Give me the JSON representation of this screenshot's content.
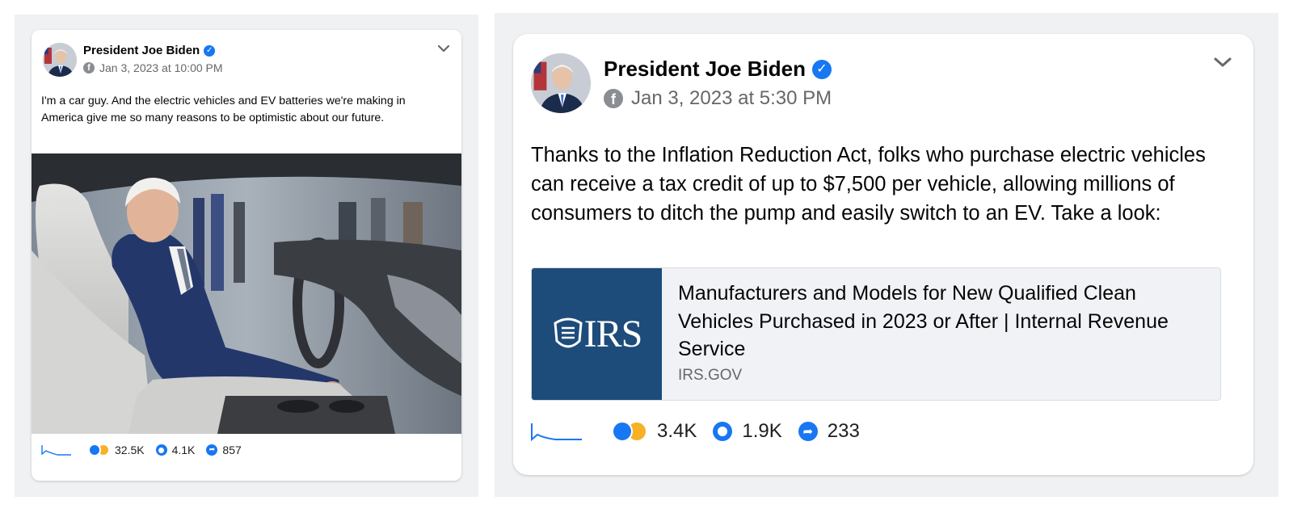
{
  "posts": [
    {
      "author": "President Joe Biden",
      "verified": true,
      "timestamp": "Jan 3, 2023 at 10:00 PM",
      "text": "I'm a car guy. And the electric vehicles and EV batteries we're making in America give me so many reasons to be optimistic about our future.",
      "media": "photo",
      "stats": {
        "reactions": "32.5K",
        "comments": "4.1K",
        "shares": "857"
      }
    },
    {
      "author": "President Joe Biden",
      "verified": true,
      "timestamp": "Jan 3, 2023 at 5:30 PM",
      "text": "Thanks to the Inflation Reduction Act, folks who purchase electric vehicles can receive a tax credit of up to $7,500 per vehicle, allowing millions of consumers to ditch the pump and easily switch to an EV. Take a look:",
      "link": {
        "logo_text": "IRS",
        "title": "Manufacturers and Models for New Qualified Clean Vehicles Purchased in 2023 or After | Internal Revenue Service",
        "domain": "IRS.GOV"
      },
      "stats": {
        "reactions": "3.4K",
        "comments": "1.9K",
        "shares": "233"
      }
    }
  ],
  "icons": [
    "verified-badge-icon",
    "facebook-icon",
    "chevron-down-icon",
    "sparkline-icon",
    "like-reaction-icon",
    "haha-reaction-icon",
    "comment-icon",
    "share-icon"
  ],
  "colors": {
    "accent": "#1877f2",
    "irs_blue": "#1d4c7a",
    "muted_text": "#65676b",
    "panel_bg": "#f0f1f3"
  }
}
